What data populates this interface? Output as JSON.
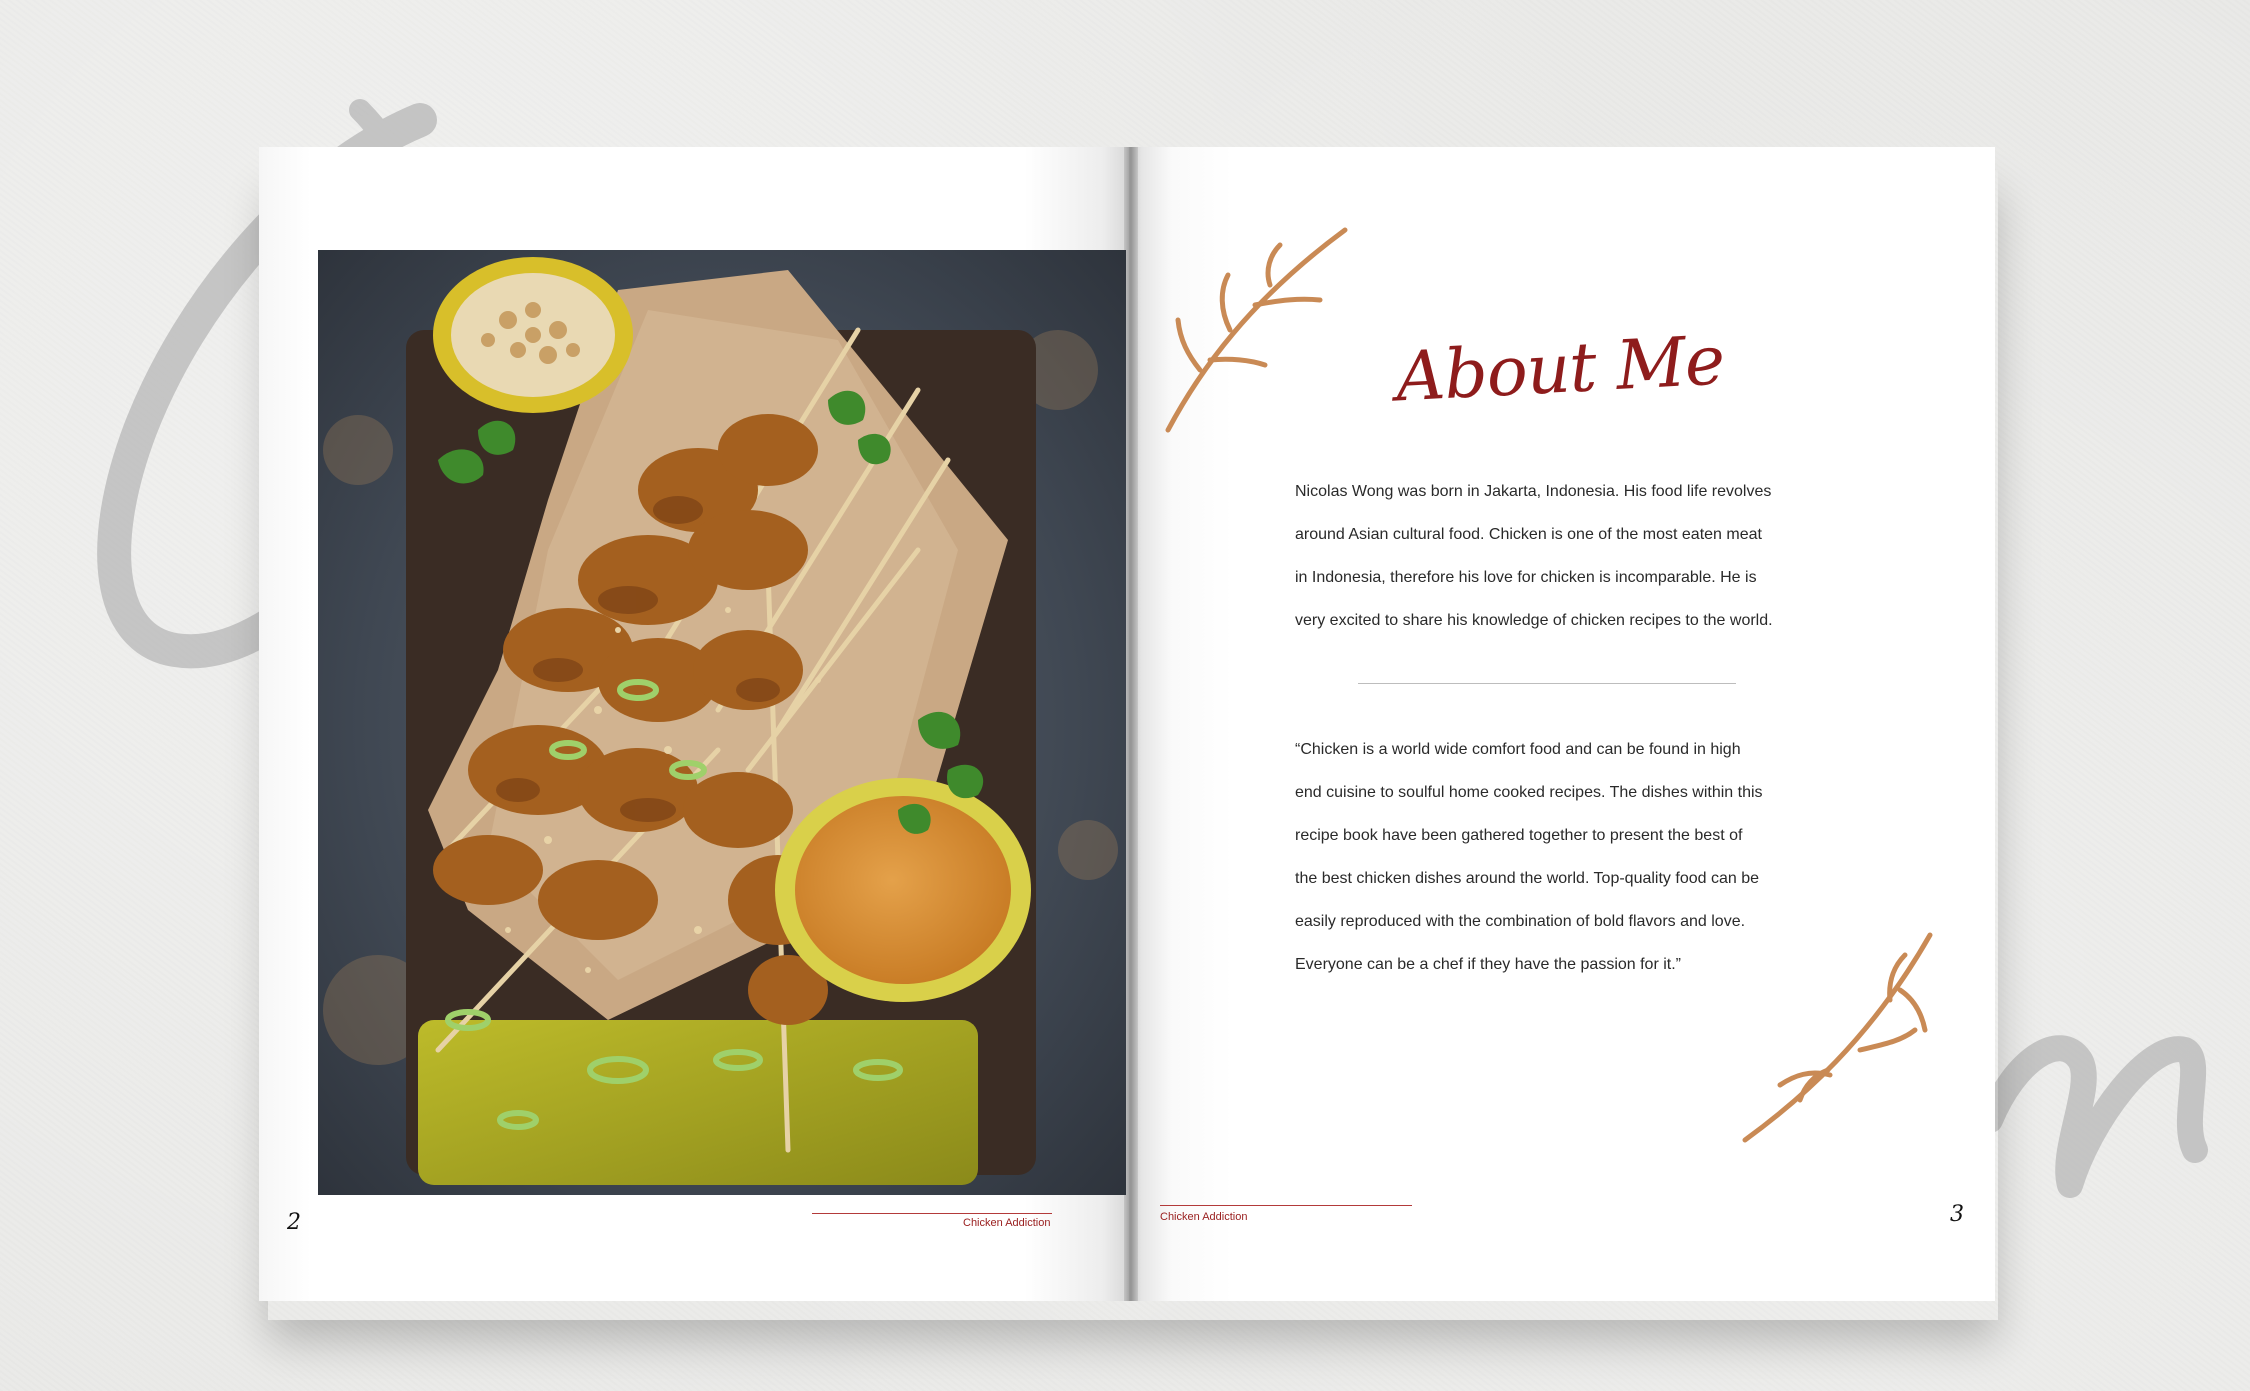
{
  "left_page": {
    "page_number": "2",
    "footer_label": "Chicken Addiction",
    "photo_description_icon": "satay-photo"
  },
  "right_page": {
    "page_number": "3",
    "footer_label": "Chicken Addiction",
    "heading": "About Me",
    "bio_lines": [
      "Nicolas Wong was born in Jakarta, Indonesia. His food life revolves",
      "around Asian cultural food. Chicken is one of the most eaten meat",
      "in Indonesia, therefore his love for chicken is incomparable. He is",
      "very excited to share his knowledge of chicken recipes to the world."
    ],
    "quote_lines": [
      "“Chicken is a world wide comfort food and can be found in high",
      "end cuisine to soulful home cooked recipes. The dishes within this",
      "recipe book have been gathered together to present the best of",
      "the best chicken dishes around the world. Top-quality food can be",
      "easily reproduced with the combination of bold flavors and love.",
      "Everyone can be a chef if they have the passion for it.”"
    ]
  },
  "colors": {
    "accent_red": "#8e1c1c",
    "sprig_tan": "#c98a55",
    "background": "#e9e9e7"
  }
}
